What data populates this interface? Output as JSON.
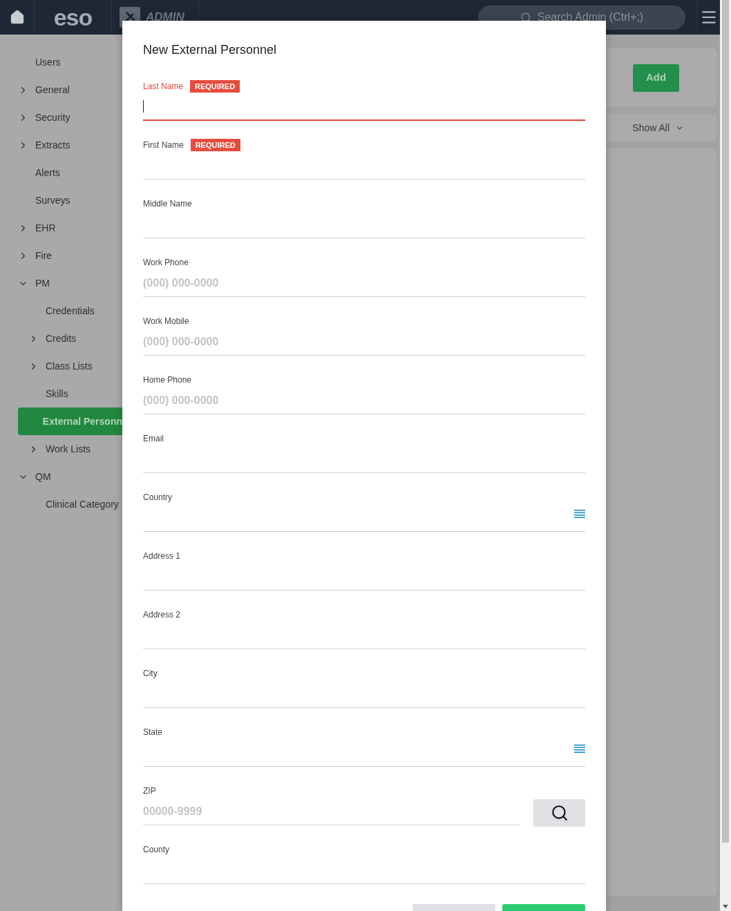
{
  "top_bar": {
    "logo": "eso",
    "section": "ADMIN",
    "search": {
      "placeholder": "Search Admin (Ctrl+;)"
    }
  },
  "sidebar": {
    "items": [
      {
        "label": "Users",
        "kind": "leaf",
        "selected": false
      },
      {
        "label": "General",
        "kind": "group",
        "expanded": false,
        "selected": false
      },
      {
        "label": "Security",
        "kind": "group",
        "expanded": false,
        "selected": false
      },
      {
        "label": "Extracts",
        "kind": "group",
        "expanded": false,
        "selected": false
      },
      {
        "label": "Alerts",
        "kind": "leaf",
        "selected": false
      },
      {
        "label": "Surveys",
        "kind": "leaf",
        "selected": false
      },
      {
        "label": "EHR",
        "kind": "group",
        "expanded": false,
        "selected": false
      },
      {
        "label": "Fire",
        "kind": "group",
        "expanded": false,
        "selected": false
      },
      {
        "label": "PM",
        "kind": "group",
        "expanded": true,
        "selected": false,
        "children": [
          {
            "label": "Credentials",
            "kind": "leaf",
            "selected": false
          },
          {
            "label": "Credits",
            "kind": "group",
            "expanded": false,
            "selected": false
          },
          {
            "label": "Class Lists",
            "kind": "group",
            "expanded": false,
            "selected": false
          },
          {
            "label": "Skills",
            "kind": "leaf",
            "selected": false
          },
          {
            "label": "External Personn",
            "kind": "leaf",
            "selected": true
          },
          {
            "label": "Work Lists",
            "kind": "group",
            "expanded": false,
            "selected": false
          }
        ]
      },
      {
        "label": "QM",
        "kind": "group",
        "expanded": true,
        "selected": false,
        "children": [
          {
            "label": "Clinical Category",
            "kind": "leaf",
            "selected": false
          }
        ]
      }
    ]
  },
  "page": {
    "add_button": "Add",
    "filter": {
      "value": "Show All"
    }
  },
  "dialog": {
    "title": "New External Personnel",
    "fields": [
      {
        "label": "Last Name",
        "kind": "text",
        "required": true,
        "badge": "REQUIRED",
        "focused": true
      },
      {
        "label": "First Name",
        "kind": "text",
        "required": true,
        "badge": "REQUIRED",
        "focused": false
      },
      {
        "label": "Middle Name",
        "kind": "text",
        "required": false,
        "focused": false
      },
      {
        "label": "Work Phone",
        "kind": "text",
        "placeholder": "(000) 000-0000",
        "required": false,
        "focused": false
      },
      {
        "label": "Work Mobile",
        "kind": "text",
        "placeholder": "(000) 000-0000",
        "required": false,
        "focused": false
      },
      {
        "label": "Home Phone",
        "kind": "text",
        "placeholder": "(000) 000-0000",
        "required": false,
        "focused": false
      },
      {
        "label": "Email",
        "kind": "text",
        "required": false,
        "focused": false
      },
      {
        "label": "Country",
        "kind": "select",
        "required": false,
        "focused": false
      },
      {
        "label": "Address 1",
        "kind": "text",
        "required": false,
        "focused": false
      },
      {
        "label": "Address 2",
        "kind": "text",
        "required": false,
        "focused": false
      },
      {
        "label": "City",
        "kind": "text",
        "required": false,
        "focused": false
      },
      {
        "label": "State",
        "kind": "select",
        "required": false,
        "focused": false
      },
      {
        "label": "ZIP",
        "kind": "lookup",
        "placeholder": "00000-9999",
        "required": false,
        "focused": false
      },
      {
        "label": "County",
        "kind": "text",
        "required": false,
        "focused": false
      }
    ],
    "footer_buttons": [
      {
        "kind": "secondary"
      },
      {
        "kind": "primary"
      }
    ]
  }
}
